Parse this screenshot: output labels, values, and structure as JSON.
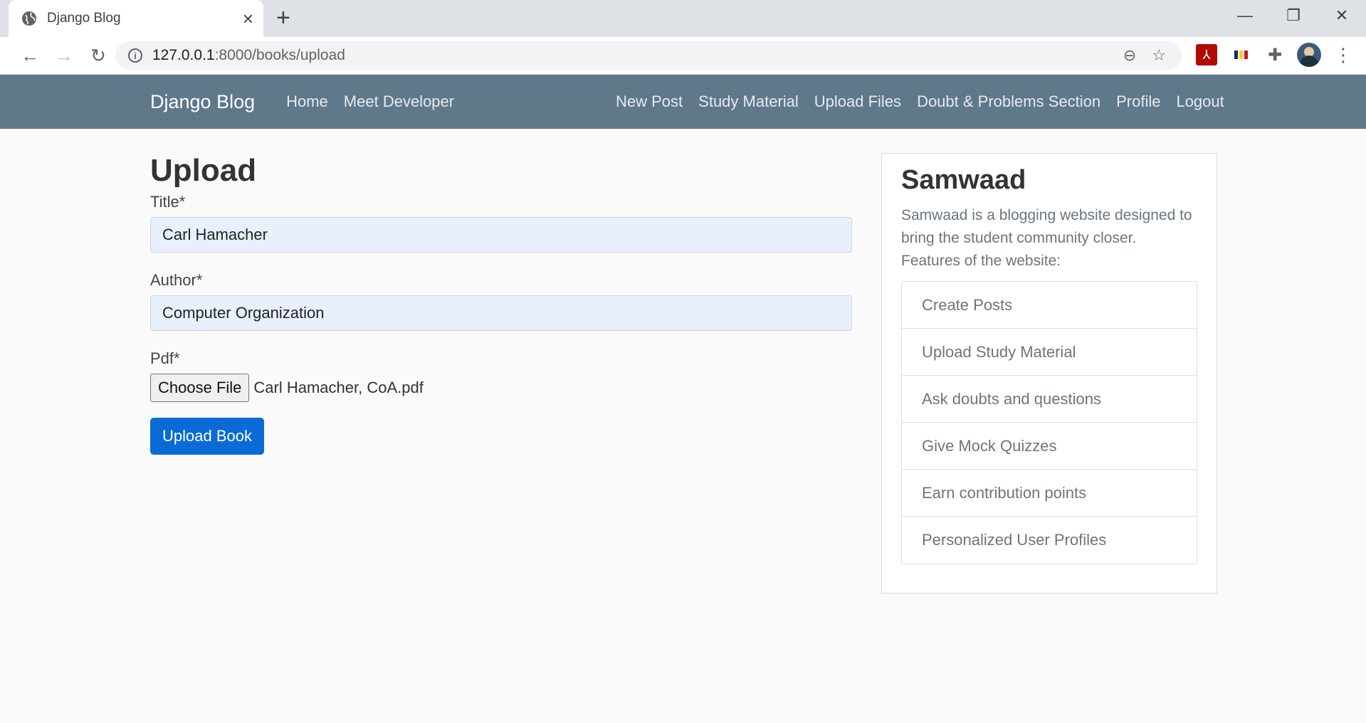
{
  "browser": {
    "tab_title": "Django Blog",
    "url_host": "127.0.0.1",
    "url_path": ":8000/books/upload"
  },
  "navbar": {
    "brand": "Django Blog",
    "left_links": [
      "Home",
      "Meet Developer"
    ],
    "right_links": [
      "New Post",
      "Study Material",
      "Upload Files",
      "Doubt & Problems Section",
      "Profile",
      "Logout"
    ]
  },
  "form": {
    "heading": "Upload",
    "title_label": "Title*",
    "title_value": "Carl Hamacher",
    "author_label": "Author*",
    "author_value": "Computer Organization",
    "pdf_label": "Pdf*",
    "choose_file_label": "Choose File",
    "file_name": "Carl Hamacher, CoA.pdf",
    "submit_label": "Upload Book"
  },
  "sidebar": {
    "title": "Samwaad",
    "description": "Samwaad is a blogging website designed to bring the student community closer. Features of the website:",
    "items": [
      "Create Posts",
      "Upload Study Material",
      "Ask doubts and questions",
      "Give Mock Quizzes",
      "Earn contribution points",
      "Personalized User Profiles"
    ]
  },
  "colors": {
    "navbar_bg": "#5f788a",
    "primary_button": "#0b6bd6",
    "autofill_bg": "#e8f0fe"
  }
}
